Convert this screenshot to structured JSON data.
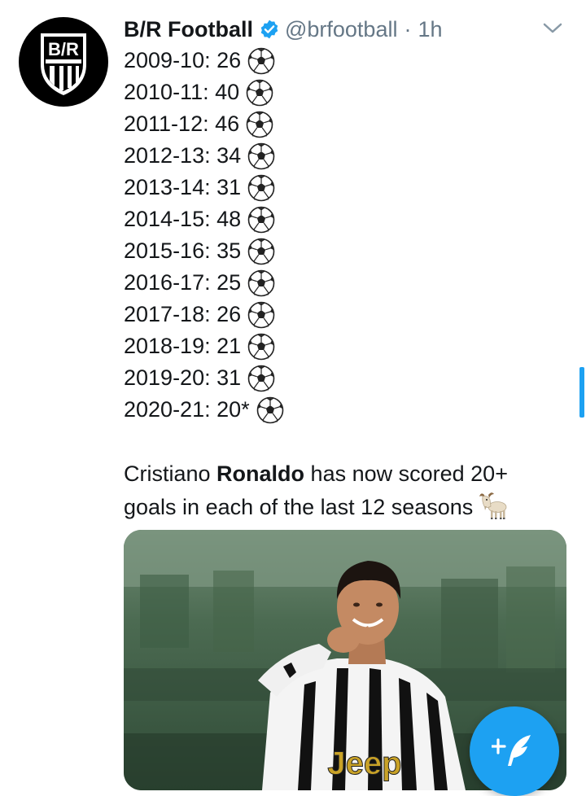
{
  "tweet": {
    "author": {
      "name": "B/R Football",
      "handle": "@brfootball",
      "logo_text": "B/R",
      "avatar_bg": "#000000",
      "verified_color": "#1da1f2"
    },
    "separator": "·",
    "time": "1h",
    "stats": [
      {
        "season": "2009-10:",
        "goals": "26"
      },
      {
        "season": "2010-11:",
        "goals": "40"
      },
      {
        "season": "2011-12:",
        "goals": "46"
      },
      {
        "season": "2012-13:",
        "goals": "34"
      },
      {
        "season": "2013-14:",
        "goals": "31"
      },
      {
        "season": "2014-15:",
        "goals": "48"
      },
      {
        "season": "2015-16:",
        "goals": "35"
      },
      {
        "season": "2016-17:",
        "goals": "25"
      },
      {
        "season": "2017-18:",
        "goals": "26"
      },
      {
        "season": "2018-19:",
        "goals": "21"
      },
      {
        "season": "2019-20:",
        "goals": "31"
      },
      {
        "season": "2020-21:",
        "goals": "20*"
      }
    ],
    "stat_icon": "soccer-ball-icon",
    "caption": {
      "prefix": "Cristiano ",
      "bold": "Ronaldo",
      "suffix": " has now scored 20+ goals in each of the last 12 seasons",
      "emoji_icon": "goat-icon"
    },
    "media": {
      "jersey_text": "Jeep"
    }
  },
  "fab": {
    "icon": "compose-tweet-icon",
    "color": "#1da1f2"
  },
  "accent": "#1da1f2"
}
